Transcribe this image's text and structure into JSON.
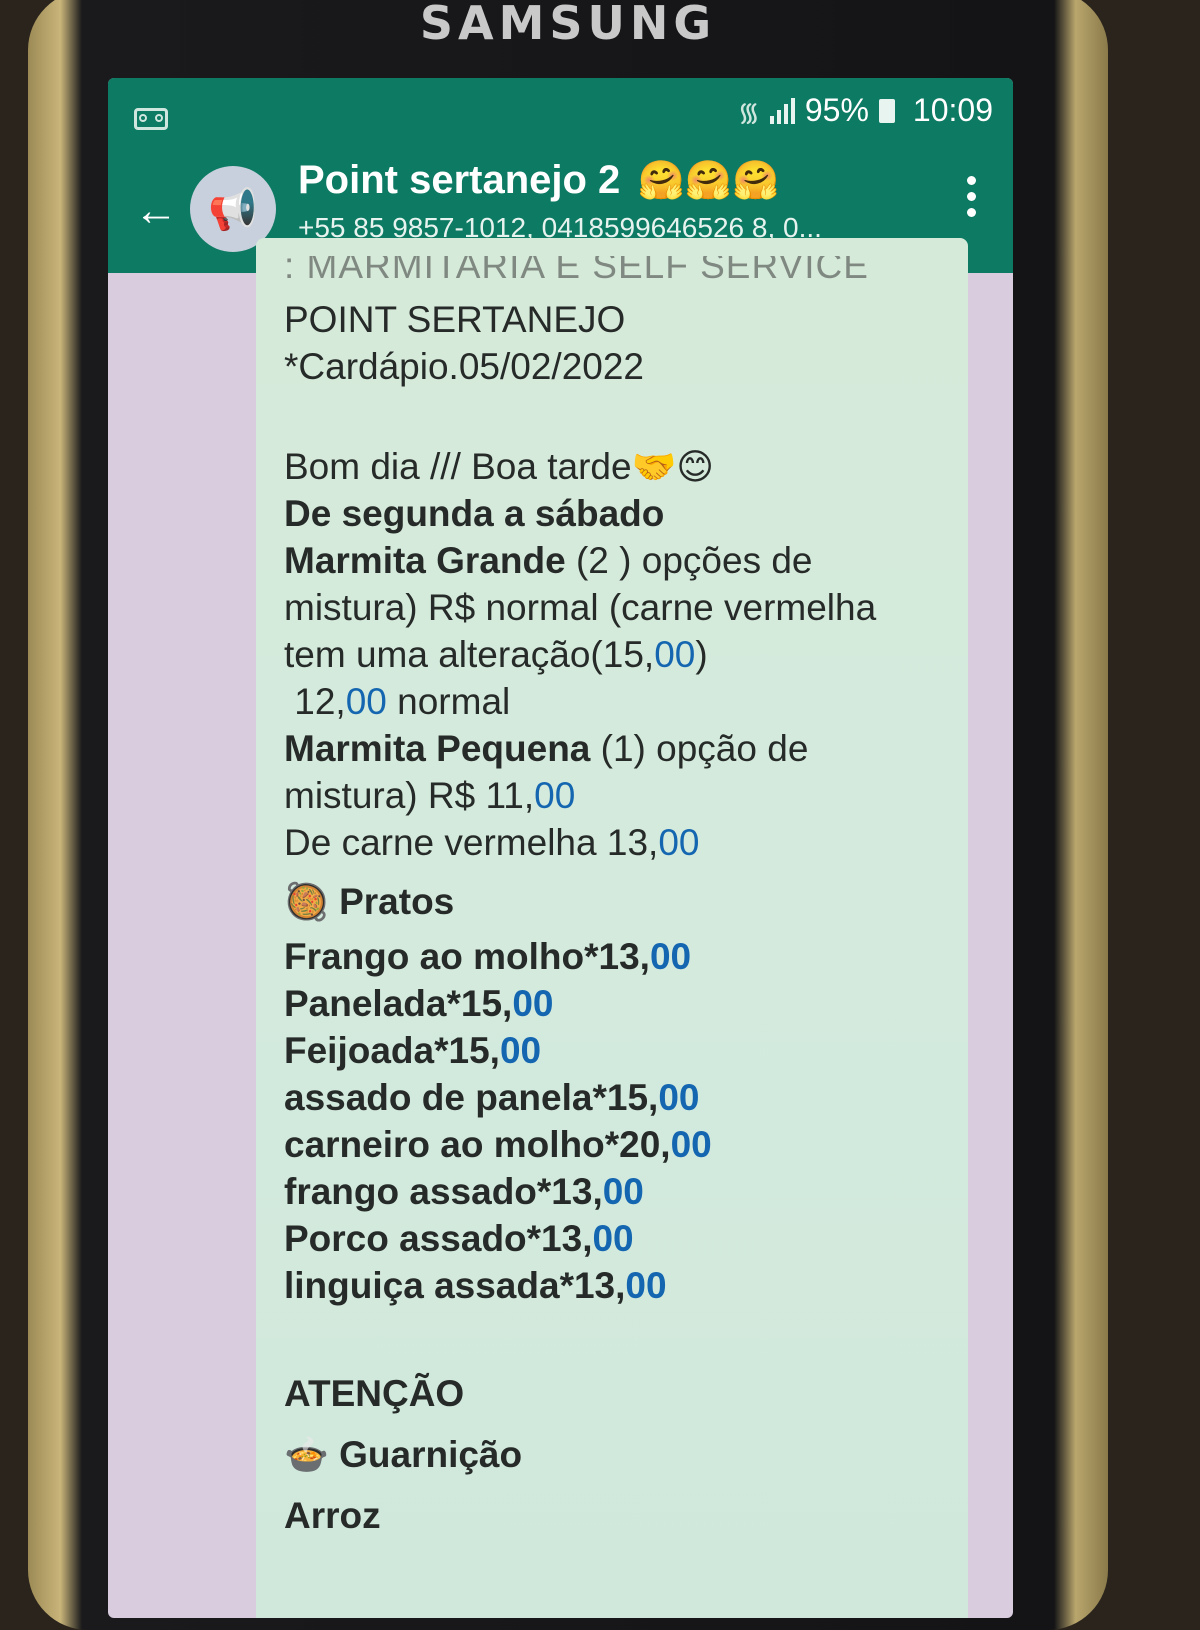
{
  "device": {
    "brand": "SAMSUNG"
  },
  "status_bar": {
    "battery": "95%",
    "time": "10:09"
  },
  "header": {
    "title": "Point sertanejo 2",
    "title_emojis": "🤗🤗🤗",
    "subtitle": "+55 85 9857-1012, 0418599646526 8, 0..."
  },
  "message": {
    "cut_line": ": MARMITARIA E SELF SERVICE",
    "name": "POINT SERTANEJO",
    "date": "*Cardápio.05/02/2022",
    "greeting": "Bom dia /// Boa tarde",
    "greeting_emojis": "🤝😊",
    "days": "De segunda a sábado",
    "grande": {
      "bold": "Marmita Grande",
      "rest": " (2 ) opções de",
      "line2": "mistura) R$  normal (carne vermelha",
      "line3_a": "tem uma alteração(15,",
      "line3_b": "00",
      "line3_c": ")",
      "line4_a": " 12,",
      "line4_b": "00",
      "line4_c": " normal"
    },
    "pequena": {
      "bold": "Marmita Pequena",
      "rest": " (1) opção de",
      "line2_a": "mistura) R$ 11,",
      "line2_b": "00",
      "line3_a": "De carne vermelha 13,",
      "line3_b": "00"
    },
    "pratos_emoji": "🥘",
    "pratos_title": "Pratos",
    "pratos": [
      {
        "name": "Frango ao molho*13,",
        "cents": "00"
      },
      {
        "name": "Panelada*15,",
        "cents": "00"
      },
      {
        "name": "Feijoada*15,",
        "cents": "00"
      },
      {
        "name": "assado de panela*15,",
        "cents": "00"
      },
      {
        "name": "carneiro ao molho*20,",
        "cents": "00"
      },
      {
        "name": "frango assado*13,",
        "cents": "00"
      },
      {
        "name": "Porco assado*13,",
        "cents": "00"
      },
      {
        "name": "linguiça assada*13,",
        "cents": "00"
      }
    ],
    "atencao": "ATENÇÃO",
    "guarnicao_emoji": "🍲",
    "guarnicao": "Guarnição",
    "arroz": "Arroz"
  },
  "colors": {
    "app_bar": "#0d7a63",
    "bubble": "#d6ead9",
    "link_blue": "#1466b0",
    "chat_bg": "#d9ccdf"
  }
}
